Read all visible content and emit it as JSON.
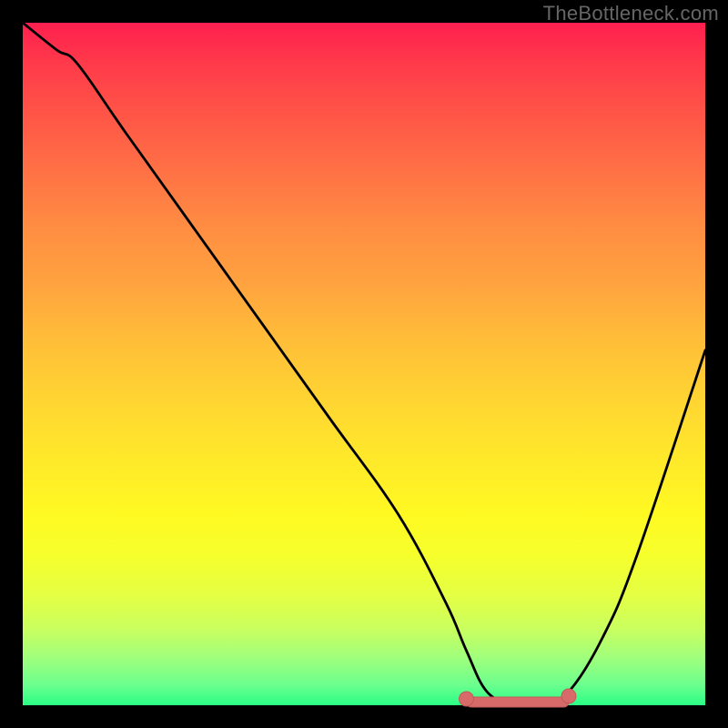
{
  "watermark": "TheBottleneck.com",
  "colors": {
    "frame_bg": "#000000",
    "curve_stroke": "#000000",
    "nodule_fill": "#d86a6a",
    "nodule_stroke": "#c05a5a",
    "gradient_top": "#ff1f4f",
    "gradient_mid": "#ffe92a",
    "gradient_bottom": "#2aff86"
  },
  "chart_data": {
    "type": "line",
    "title": "TheBottleneck.com",
    "xlabel": "",
    "ylabel": "",
    "xlim": [
      0,
      100
    ],
    "ylim": [
      0,
      100
    ],
    "grid": false,
    "legend": false,
    "series": [
      {
        "name": "bottleneck-curve",
        "x": [
          0,
          5,
          8,
          15,
          25,
          35,
          45,
          55,
          62,
          65,
          68,
          72,
          76,
          80,
          85,
          90,
          100
        ],
        "values": [
          100,
          96,
          94,
          84,
          70,
          56,
          42,
          28,
          15,
          8,
          2,
          0,
          0,
          2,
          10,
          22,
          52
        ]
      }
    ],
    "annotations": [
      {
        "name": "flat-minimum-nodule",
        "x_start": 65,
        "x_end": 80,
        "y": 0
      }
    ]
  }
}
